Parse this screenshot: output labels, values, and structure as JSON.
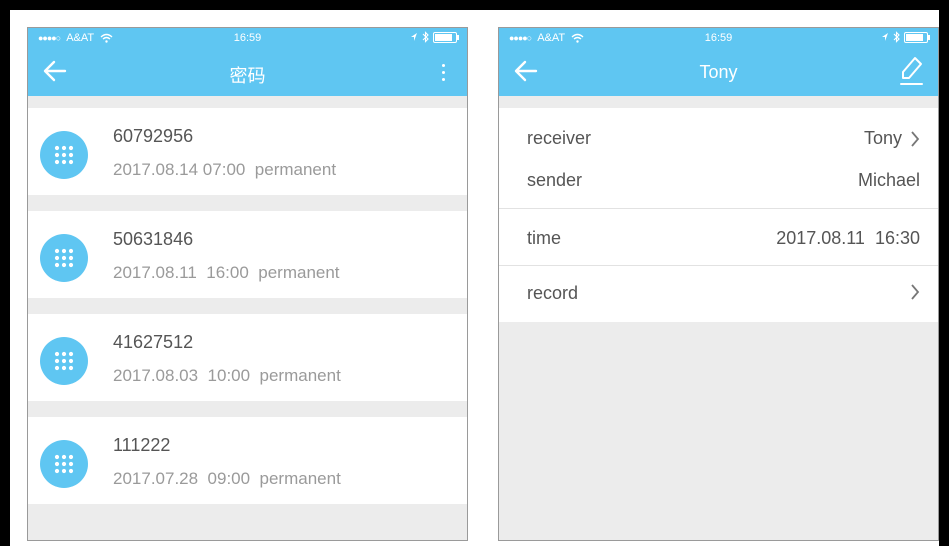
{
  "status_bar": {
    "signal": "●●●●○",
    "carrier": "A&AT",
    "time": "16:59"
  },
  "left_screen": {
    "title": "密码",
    "passwords": [
      {
        "code": "60792956",
        "meta": "2017.08.14 07:00  permanent"
      },
      {
        "code": "50631846",
        "meta": "2017.08.11  16:00  permanent"
      },
      {
        "code": "41627512",
        "meta": "2017.08.03  10:00  permanent"
      },
      {
        "code": "111222",
        "meta": "2017.07.28  09:00  permanent"
      }
    ]
  },
  "right_screen": {
    "title": "Tony",
    "receiver_label": "receiver",
    "receiver_value": "Tony",
    "sender_label": "sender",
    "sender_value": "Michael",
    "time_label": "time",
    "time_value": "2017.08.11  16:30",
    "record_label": "record"
  },
  "colors": {
    "accent": "#5fc6f2",
    "background": "#ececec",
    "text_primary": "#555555",
    "text_secondary": "#9a9a9a"
  },
  "icons": [
    "back-arrow-icon",
    "more-vertical-icon",
    "edit-icon",
    "keypad-icon",
    "chevron-right-icon",
    "wifi-icon",
    "location-icon",
    "bluetooth-icon",
    "battery-icon"
  ]
}
